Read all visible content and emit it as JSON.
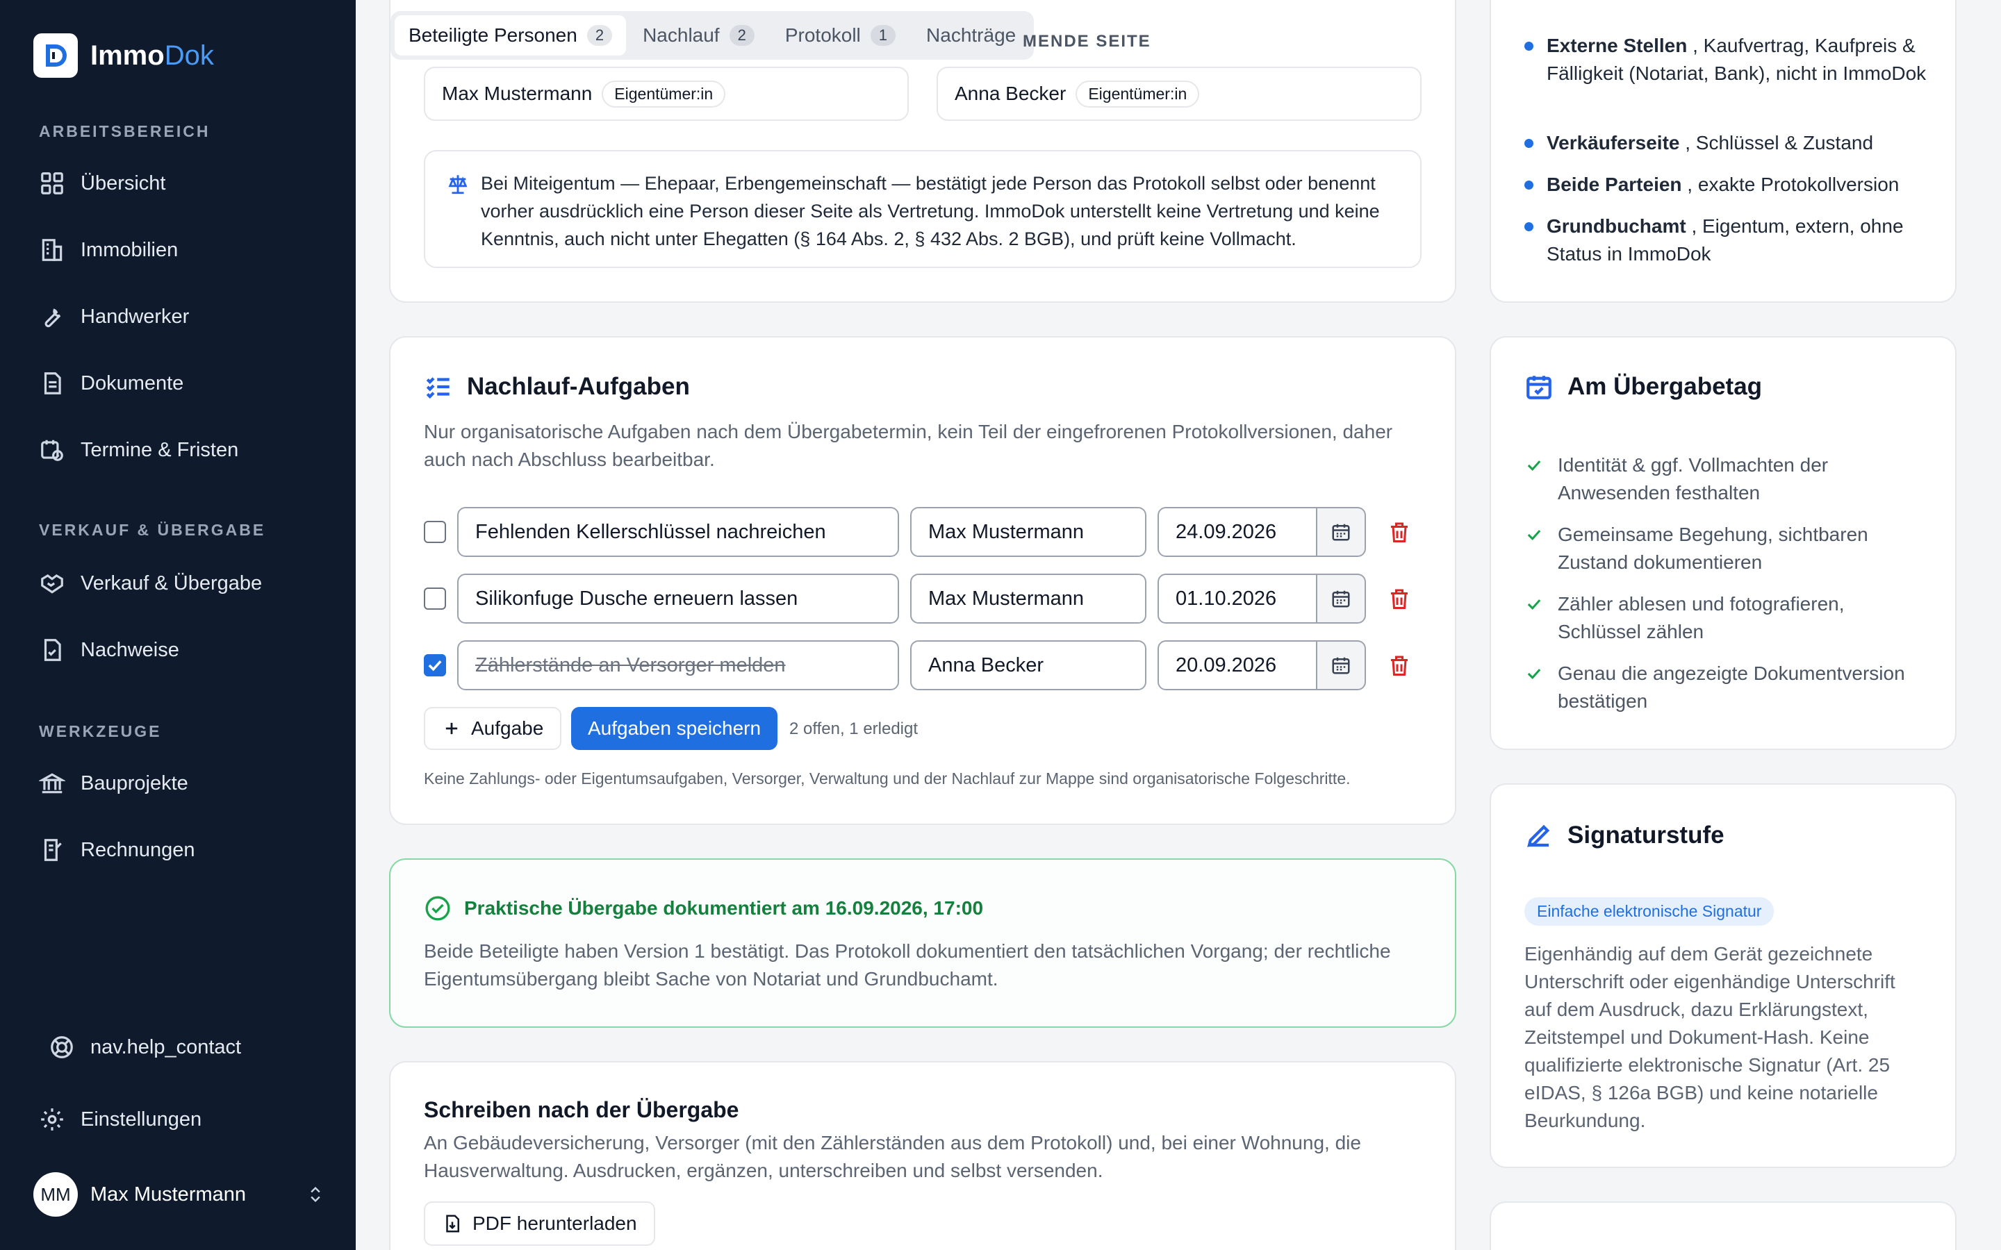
{
  "app": {
    "name_main": "Immo",
    "name_accent": "Dok"
  },
  "sidebar": {
    "section_workspace": "ARBEITSBEREICH",
    "items_workspace": [
      {
        "label": "Übersicht",
        "icon": "grid-icon"
      },
      {
        "label": "Immobilien",
        "icon": "building-icon"
      },
      {
        "label": "Handwerker",
        "icon": "wrench-icon"
      },
      {
        "label": "Dokumente",
        "icon": "document-icon"
      },
      {
        "label": "Termine & Fristen",
        "icon": "calendar-clock-icon"
      }
    ],
    "section_sale": "VERKAUF & ÜBERGABE",
    "items_sale": [
      {
        "label": "Verkauf & Übergabe",
        "icon": "handshake-icon"
      },
      {
        "label": "Nachweise",
        "icon": "document-check-icon"
      }
    ],
    "section_tools": "WERKZEUGE",
    "items_tools": [
      {
        "label": "Bauprojekte",
        "icon": "bank-icon"
      },
      {
        "label": "Rechnungen",
        "icon": "invoice-icon"
      }
    ],
    "help_label": "nav.help_contact",
    "settings_label": "Einstellungen",
    "user": {
      "initials": "MM",
      "name": "Max Mustermann"
    }
  },
  "tabs": [
    {
      "label": "Beteiligte Personen",
      "count": "2",
      "active": true
    },
    {
      "label": "Nachlauf",
      "count": "2"
    },
    {
      "label": "Protokoll",
      "count": "1"
    },
    {
      "label": "Nachträge",
      "count": ""
    }
  ],
  "persons": {
    "section_label_partial": "MENDE SEITE",
    "left": {
      "name": "Max Mustermann",
      "role": "Eigentümer:in"
    },
    "right": {
      "name": "Anna Becker",
      "role": "Eigentümer:in"
    },
    "note": "Bei Miteigentum — Ehepaar, Erbengemeinschaft — bestätigt jede Person das Protokoll selbst oder benennt vorher ausdrücklich eine Person dieser Seite als Vertretung. ImmoDok unterstellt keine Vertretung und keine Kenntnis, auch nicht unter Ehegatten (§ 164 Abs. 2, § 432 Abs. 2 BGB), und prüft keine Vollmacht."
  },
  "tasks": {
    "title": "Nachlauf-Aufgaben",
    "description": "Nur organisatorische Aufgaben nach dem Übergabetermin, kein Teil der eingefrorenen Protokollversionen, daher auch nach Abschluss bearbeitbar.",
    "rows": [
      {
        "text": "Fehlenden Kellerschlüssel nachreichen",
        "person": "Max Mustermann",
        "date": "24.09.2026",
        "done": false
      },
      {
        "text": "Silikonfuge Dusche erneuern lassen",
        "person": "Max Mustermann",
        "date": "01.10.2026",
        "done": false
      },
      {
        "text": "Zählerstände an Versorger melden",
        "person": "Anna Becker",
        "date": "20.09.2026",
        "done": true
      }
    ],
    "add_label": "Aufgabe",
    "save_label": "Aufgaben speichern",
    "status": "2 offen, 1 erledigt",
    "footnote": "Keine Zahlungs- oder Eigentumsaufgaben, Versorger, Verwaltung und der Nachlauf zur Mappe sind organisatorische Folgeschritte."
  },
  "handover": {
    "title": "Praktische Übergabe dokumentiert am 16.09.2026, 17:00",
    "text": "Beide Beteiligte haben Version 1 bestätigt. Das Protokoll dokumentiert den tatsächlichen Vorgang; der rechtliche Eigentumsübergang bleibt Sache von Notariat und Grundbuchamt."
  },
  "letters": {
    "title": "Schreiben nach der Übergabe",
    "text": "An Gebäudeversicherung, Versorger (mit den Zählerständen aus dem Protokoll) und, bei einer Wohnung, die Hausverwaltung. Ausdrucken, ergänzen, unterschreiben und selbst versenden.",
    "pdf_label": "PDF herunterladen"
  },
  "responsibilities": [
    {
      "strong": "Externe Stellen",
      "rest": " , Kaufvertrag, Kaufpreis & Fälligkeit (Notariat, Bank), nicht in ImmoDok"
    },
    {
      "strong": "Verkäuferseite",
      "rest": " , Schlüssel & Zustand"
    },
    {
      "strong": "Beide Parteien",
      "rest": " , exakte Protokollversion"
    },
    {
      "strong": "Grundbuchamt",
      "rest": " , Eigentum, extern, ohne Status in ImmoDok"
    }
  ],
  "handover_day": {
    "title": "Am Übergabetag",
    "items": [
      "Identität & ggf. Vollmachten der Anwesenden festhalten",
      "Gemeinsame Begehung, sichtbaren Zustand dokumentieren",
      "Zähler ablesen und fotografieren, Schlüssel zählen",
      "Genau die angezeigte Dokumentversion bestätigen"
    ]
  },
  "signature": {
    "title": "Signaturstufe",
    "badge": "Einfache elektronische Signatur",
    "text": "Eigenhändig auf dem Gerät gezeichnete Unterschrift oder eigenhändige Unterschrift auf dem Ausdruck, dazu Erklärungstext, Zeitstempel und Dokument-Hash. Keine qualifizierte elektronische Signatur (Art. 25 eIDAS, § 126a BGB) und keine notarielle Beurkundung."
  },
  "colors": {
    "accent": "#1f6fe0",
    "sidebar": "#0f1b2d",
    "success": "#16a34a"
  }
}
